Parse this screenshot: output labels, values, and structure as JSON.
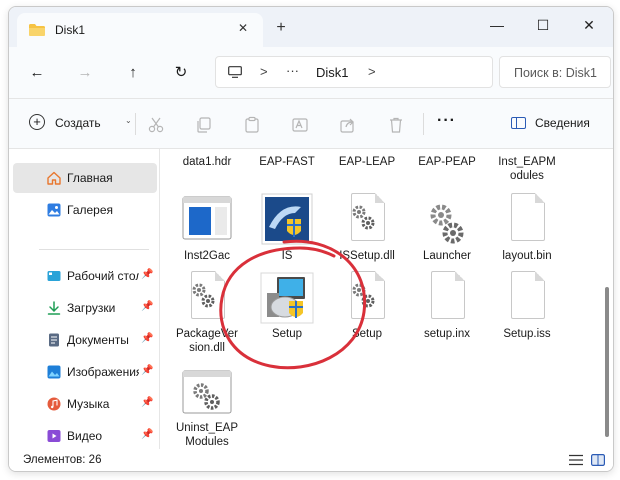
{
  "window": {
    "tab_title": "Disk1",
    "new_tab_symbol": "+",
    "close_tab_symbol": "✕",
    "minimize_symbol": "—",
    "maximize_symbol": "☐",
    "close_symbol": "✕"
  },
  "nav": {
    "back_symbol": "←",
    "forward_symbol": "→",
    "up_symbol": "↑",
    "refresh_symbol": "↻"
  },
  "address": {
    "separator": ">",
    "ellipsis": "···",
    "crumb": "Disk1"
  },
  "search": {
    "placeholder": "Поиск в: Disk1"
  },
  "toolbar": {
    "create_label": "Создать",
    "more_symbol": "···",
    "details_label": "Сведения"
  },
  "sidebar": {
    "items": [
      {
        "label": "Главная",
        "icon": "home-icon"
      },
      {
        "label": "Галерея",
        "icon": "gallery-icon"
      },
      {
        "label": "Рабочий стол",
        "icon": "desktop-icon"
      },
      {
        "label": "Загрузки",
        "icon": "downloads-icon"
      },
      {
        "label": "Документы",
        "icon": "documents-icon"
      },
      {
        "label": "Изображения",
        "icon": "pictures-icon"
      },
      {
        "label": "Музыка",
        "icon": "music-icon"
      },
      {
        "label": "Видео",
        "icon": "videos-icon"
      }
    ],
    "pin_symbol": "📌"
  },
  "files": {
    "row0": [
      "data1.hdr",
      "EAP-FAST",
      "EAP-LEAP",
      "EAP-PEAP",
      "Inst_EAPM\nodules"
    ],
    "row1": [
      "Inst2Gac",
      "IS",
      "ISSetup.dll",
      "Launcher",
      "layout.bin"
    ],
    "row2": [
      "PackageVer\nsion.dll",
      "Setup",
      "Setup",
      "setup.inx",
      "Setup.iss"
    ],
    "row3": [
      "Uninst_EAP\nModules"
    ]
  },
  "status": {
    "count": "Элементов: 26"
  },
  "colors": {
    "accent": "#2b5bb5",
    "annotation": "#d9303a",
    "folder": "#f6c343"
  }
}
